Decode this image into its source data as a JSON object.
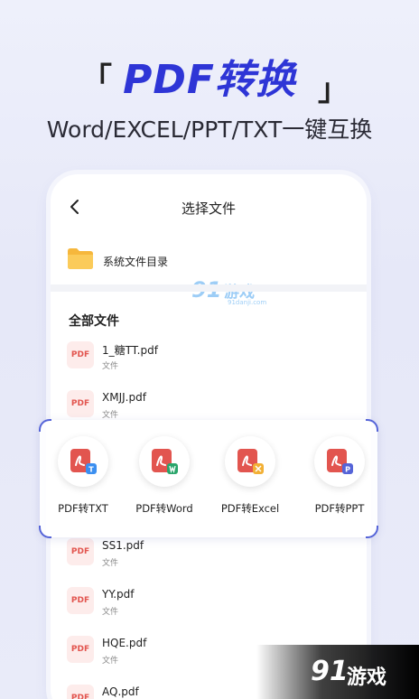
{
  "hero": {
    "title": "PDF转换",
    "bracket_left": "「",
    "bracket_right": "」",
    "subtitle": "Word/EXCEL/PPT/TXT一键互换"
  },
  "screen": {
    "title": "选择文件",
    "back_icon": "back-chevron-icon",
    "folder": {
      "label": "系统文件目录",
      "icon": "folder-icon"
    },
    "section_title": "全部文件",
    "files": [
      {
        "badge": "PDF",
        "name": "1_糖TT.pdf",
        "type": "文件"
      },
      {
        "badge": "PDF",
        "name": "XMJJ.pdf",
        "type": "文件"
      },
      {
        "badge": "PDF",
        "name": "SS1.pdf",
        "type": "文件"
      },
      {
        "badge": "PDF",
        "name": "YY.pdf",
        "type": "文件"
      },
      {
        "badge": "PDF",
        "name": "HQE.pdf",
        "type": "文件"
      },
      {
        "badge": "PDF",
        "name": "AQ.pdf",
        "type": "文件"
      }
    ]
  },
  "tools": [
    {
      "label": "PDF转TXT",
      "badge_color": "#3b8ff0"
    },
    {
      "label": "PDF转Word",
      "badge_color": "#2aa56b"
    },
    {
      "label": "PDF转Excel",
      "badge_color": "#f2b035"
    },
    {
      "label": "PDF转PPT",
      "badge_color": "#5564d8"
    }
  ],
  "watermark": {
    "num": "91",
    "text": "游戏",
    "url": "91danji.com"
  },
  "corner_logo": {
    "num": "91",
    "text": "游戏"
  },
  "colors": {
    "accent": "#2e35d6",
    "pdf_red": "#e2554f",
    "panel_border": "#5564d8"
  }
}
